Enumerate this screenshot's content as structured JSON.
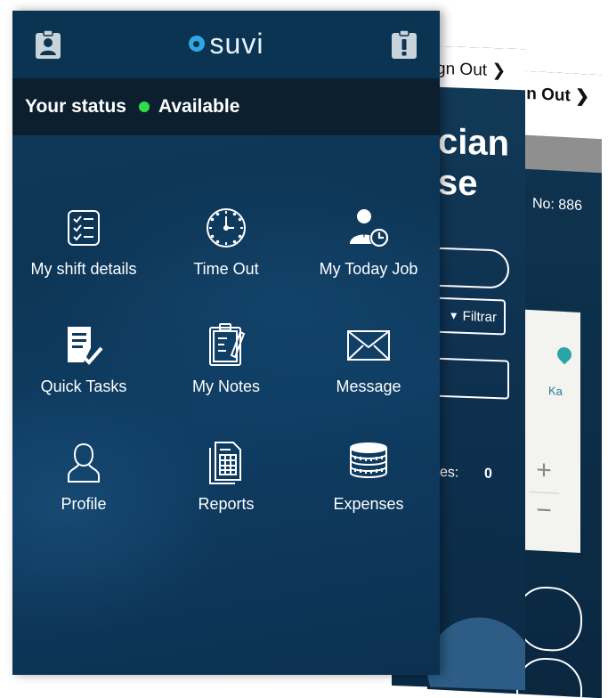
{
  "app": {
    "brand": "SUVI",
    "brand_text": "suvi"
  },
  "header": {
    "left_icon": "id-badge-icon",
    "right_icon": "alert-clipboard-icon"
  },
  "status": {
    "label": "Your status",
    "value": "Available",
    "color": "#2fdc4a"
  },
  "menu": [
    {
      "label": "My shift details",
      "icon": "checklist-icon"
    },
    {
      "label": "Time Out",
      "icon": "clock-icon"
    },
    {
      "label": "My Today Job",
      "icon": "worker-clock-icon"
    },
    {
      "label": "Quick Tasks",
      "icon": "task-doc-icon"
    },
    {
      "label": "My Notes",
      "icon": "notes-clipboard-icon"
    },
    {
      "label": "Message",
      "icon": "envelope-icon"
    },
    {
      "label": "Profile",
      "icon": "person-icon"
    },
    {
      "label": "Reports",
      "icon": "report-doc-icon"
    },
    {
      "label": "Expenses",
      "icon": "coin-stack-icon"
    }
  ],
  "background_screens": {
    "middle": {
      "signout": "gn Out",
      "title": "cian\nse",
      "filter": "Filtrar",
      "count_label": "es:",
      "count_value": "0"
    },
    "back": {
      "signout": "n Out",
      "number": "No: 886",
      "map_place": "Ka",
      "zoom_in": "+",
      "zoom_out": "−"
    }
  },
  "colors": {
    "appbar": "#0b3352",
    "statusbar": "#0c1f2f",
    "logo_accent": "#2fa7e0"
  }
}
